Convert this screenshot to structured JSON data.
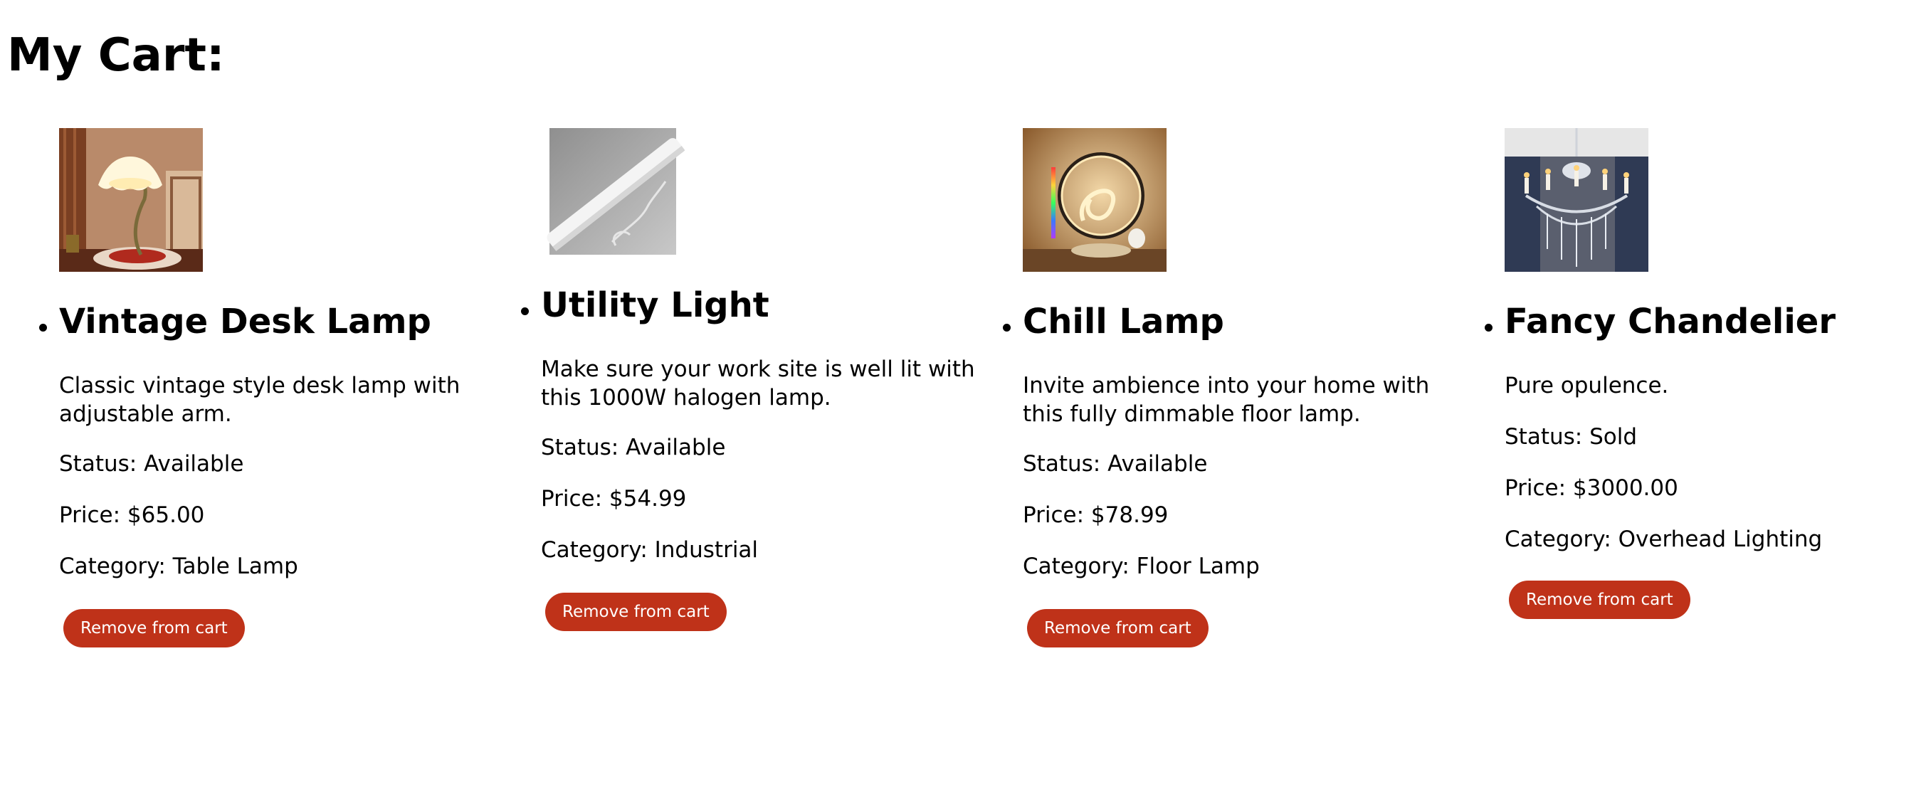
{
  "page": {
    "title": "My Cart:"
  },
  "cart": {
    "items": [
      {
        "name": "Vintage Desk Lamp",
        "description": "Classic vintage style desk lamp with adjustable arm.",
        "status": "Status: Available",
        "price": "Price: $65.00",
        "category": "Category: Table Lamp",
        "remove_label": "Remove from cart",
        "image_icon": "vintage-desk-lamp-photo"
      },
      {
        "name": "Utility Light",
        "description": "Make sure your work site is well lit with this 1000W halogen lamp.",
        "status": "Status: Available",
        "price": "Price: $54.99",
        "category": "Category: Industrial",
        "remove_label": "Remove from cart",
        "image_icon": "utility-light-photo"
      },
      {
        "name": "Chill Lamp",
        "description": "Invite ambience into your home with this fully dimmable floor lamp.",
        "status": "Status: Available",
        "price": "Price: $78.99",
        "category": "Category: Floor Lamp",
        "remove_label": "Remove from cart",
        "image_icon": "chill-lamp-photo"
      },
      {
        "name": "Fancy Chandelier",
        "description": "Pure opulence.",
        "status": "Status: Sold",
        "price": "Price: $3000.00",
        "category": "Category: Overhead Lighting",
        "remove_label": "Remove from cart",
        "image_icon": "chandelier-photo"
      }
    ]
  },
  "colors": {
    "button_background": "#bf3219",
    "button_text": "#ffffff",
    "text": "#000000",
    "background": "#ffffff"
  }
}
